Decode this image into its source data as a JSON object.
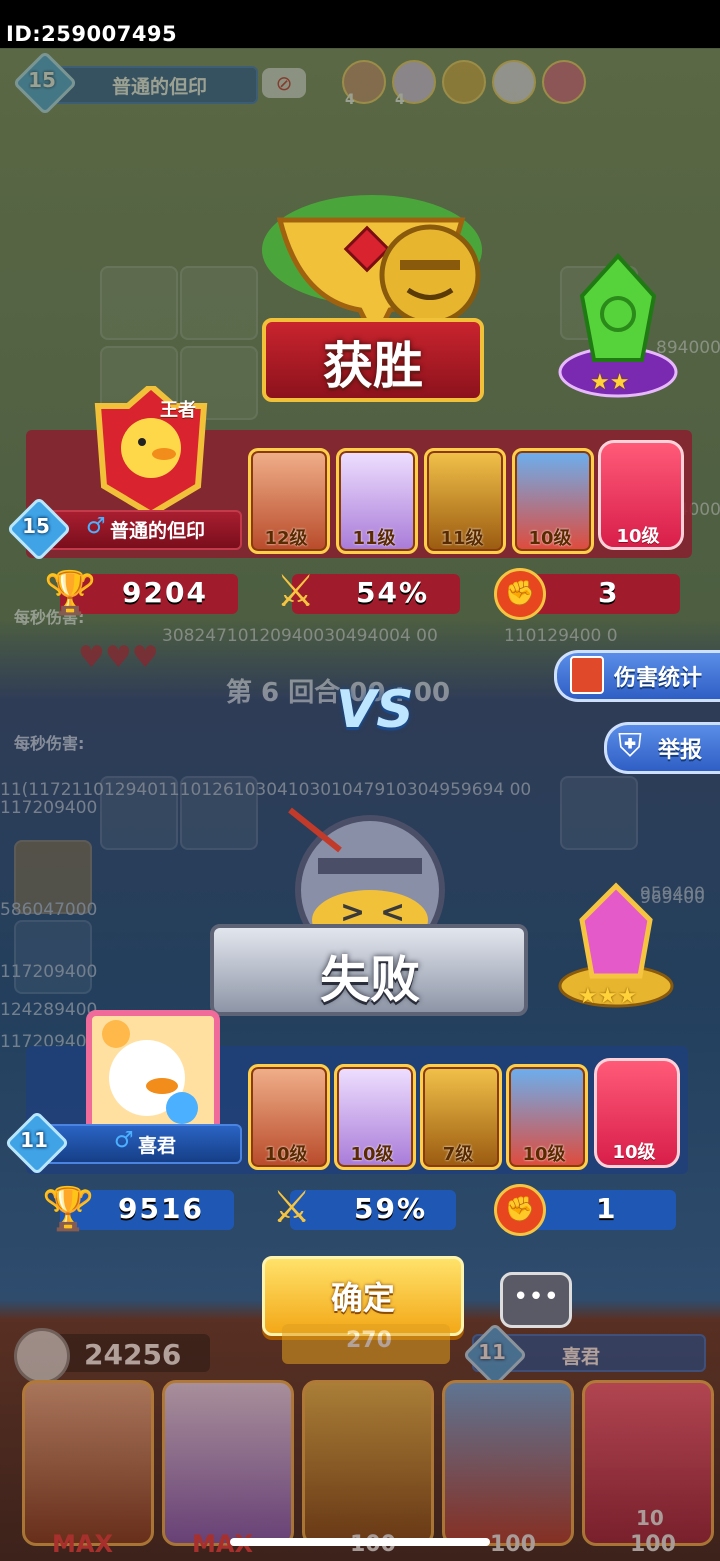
{
  "header": {
    "player_id": "ID:259007495"
  },
  "background_hud": {
    "player_level": "15",
    "player_name": "普通的但印",
    "mini_heroes": [
      {
        "stars": "4"
      },
      {
        "stars": "4"
      },
      {
        "stars": ""
      },
      {
        "stars": ""
      },
      {
        "stars": ""
      }
    ],
    "dps_label_top": "每秒伤害:",
    "dps_label_bottom": "每秒伤害:",
    "round_text": "第 6 回合 00 : 00",
    "floating_numbers": [
      "30824710120940030494004 00",
      "110129400 0",
      "11(11721101294011101261030410301047910304959694 00",
      "117209400",
      "586047000",
      "117209400",
      "124289400",
      "117209400",
      "959400",
      "894000",
      "894000",
      "969400"
    ]
  },
  "result": {
    "winner": {
      "banner": "获胜",
      "rank_badge": "王者",
      "level": "15",
      "name": "普通的但印",
      "gem_stars": 2,
      "heroes": [
        {
          "level": "12级"
        },
        {
          "level": "11级"
        },
        {
          "level": "11级"
        },
        {
          "level": "10级"
        },
        {
          "level": "10级"
        }
      ],
      "trophies": "9204",
      "win_rate": "54%",
      "wins": "3"
    },
    "vs_label": "VS",
    "loser": {
      "banner": "失败",
      "level": "11",
      "name": "喜君",
      "gem_stars": 3,
      "heroes": [
        {
          "level": "10级"
        },
        {
          "level": "10级"
        },
        {
          "level": "7级"
        },
        {
          "level": "10级"
        },
        {
          "level": "10级"
        }
      ],
      "trophies": "9516",
      "win_rate": "59%",
      "wins": "1"
    }
  },
  "side_buttons": {
    "damage_stats": "伤害统计",
    "report": "举报"
  },
  "confirm_label": "确定",
  "bottom_hud": {
    "coins": "24256",
    "energy": "270",
    "opponent_level": "11",
    "opponent_name": "喜君",
    "card_tags": [
      "MAX",
      "MAX",
      "",
      "",
      ""
    ],
    "card_costs": [
      "",
      "",
      "100",
      "100",
      "100"
    ],
    "card_badge": "10"
  },
  "colors": {
    "winner_panel": "#8a1e2e",
    "loser_panel": "#1e3f7a",
    "stat_winner": "#a01c2c",
    "stat_loser": "#1f58b4",
    "gold": "#f5c542"
  }
}
